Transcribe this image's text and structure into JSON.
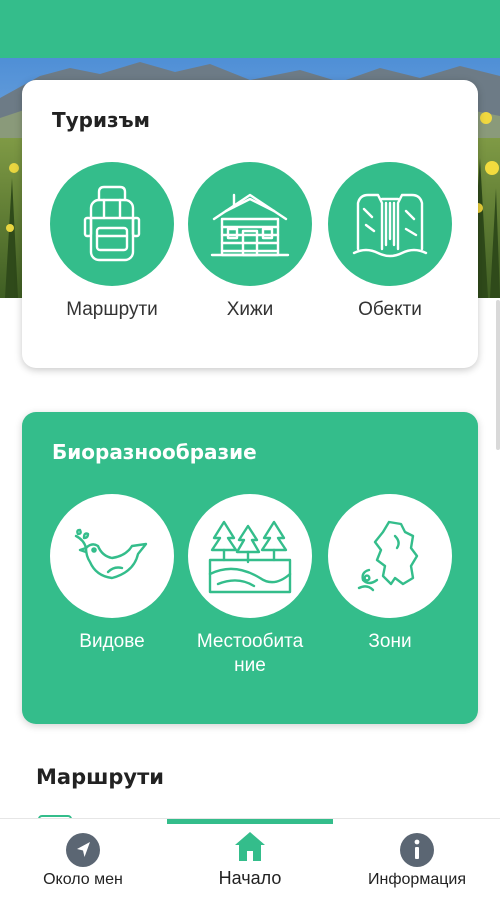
{
  "colors": {
    "accent": "#34bd8b",
    "text_dark": "#222222",
    "nav_icon": "#5b6673"
  },
  "tourism": {
    "title": "Туризъм",
    "items": [
      {
        "label": "Маршрути",
        "icon": "backpack-icon"
      },
      {
        "label": "Хижи",
        "icon": "hut-icon"
      },
      {
        "label": "Обекти",
        "icon": "waterfall-icon"
      }
    ]
  },
  "biodiversity": {
    "title": "Биоразнообразие",
    "items": [
      {
        "label": "Видове",
        "icon": "dove-icon"
      },
      {
        "label": "Местообита ние",
        "icon": "forest-icon"
      },
      {
        "label": "Зони",
        "icon": "map-region-icon"
      }
    ]
  },
  "section": {
    "title": "Маршрути"
  },
  "nav": {
    "items": [
      {
        "label": "Около мен",
        "icon": "navigation-arrow-icon"
      },
      {
        "label": "Начало",
        "icon": "home-icon",
        "active": true
      },
      {
        "label": "Информация",
        "icon": "info-icon"
      }
    ]
  }
}
